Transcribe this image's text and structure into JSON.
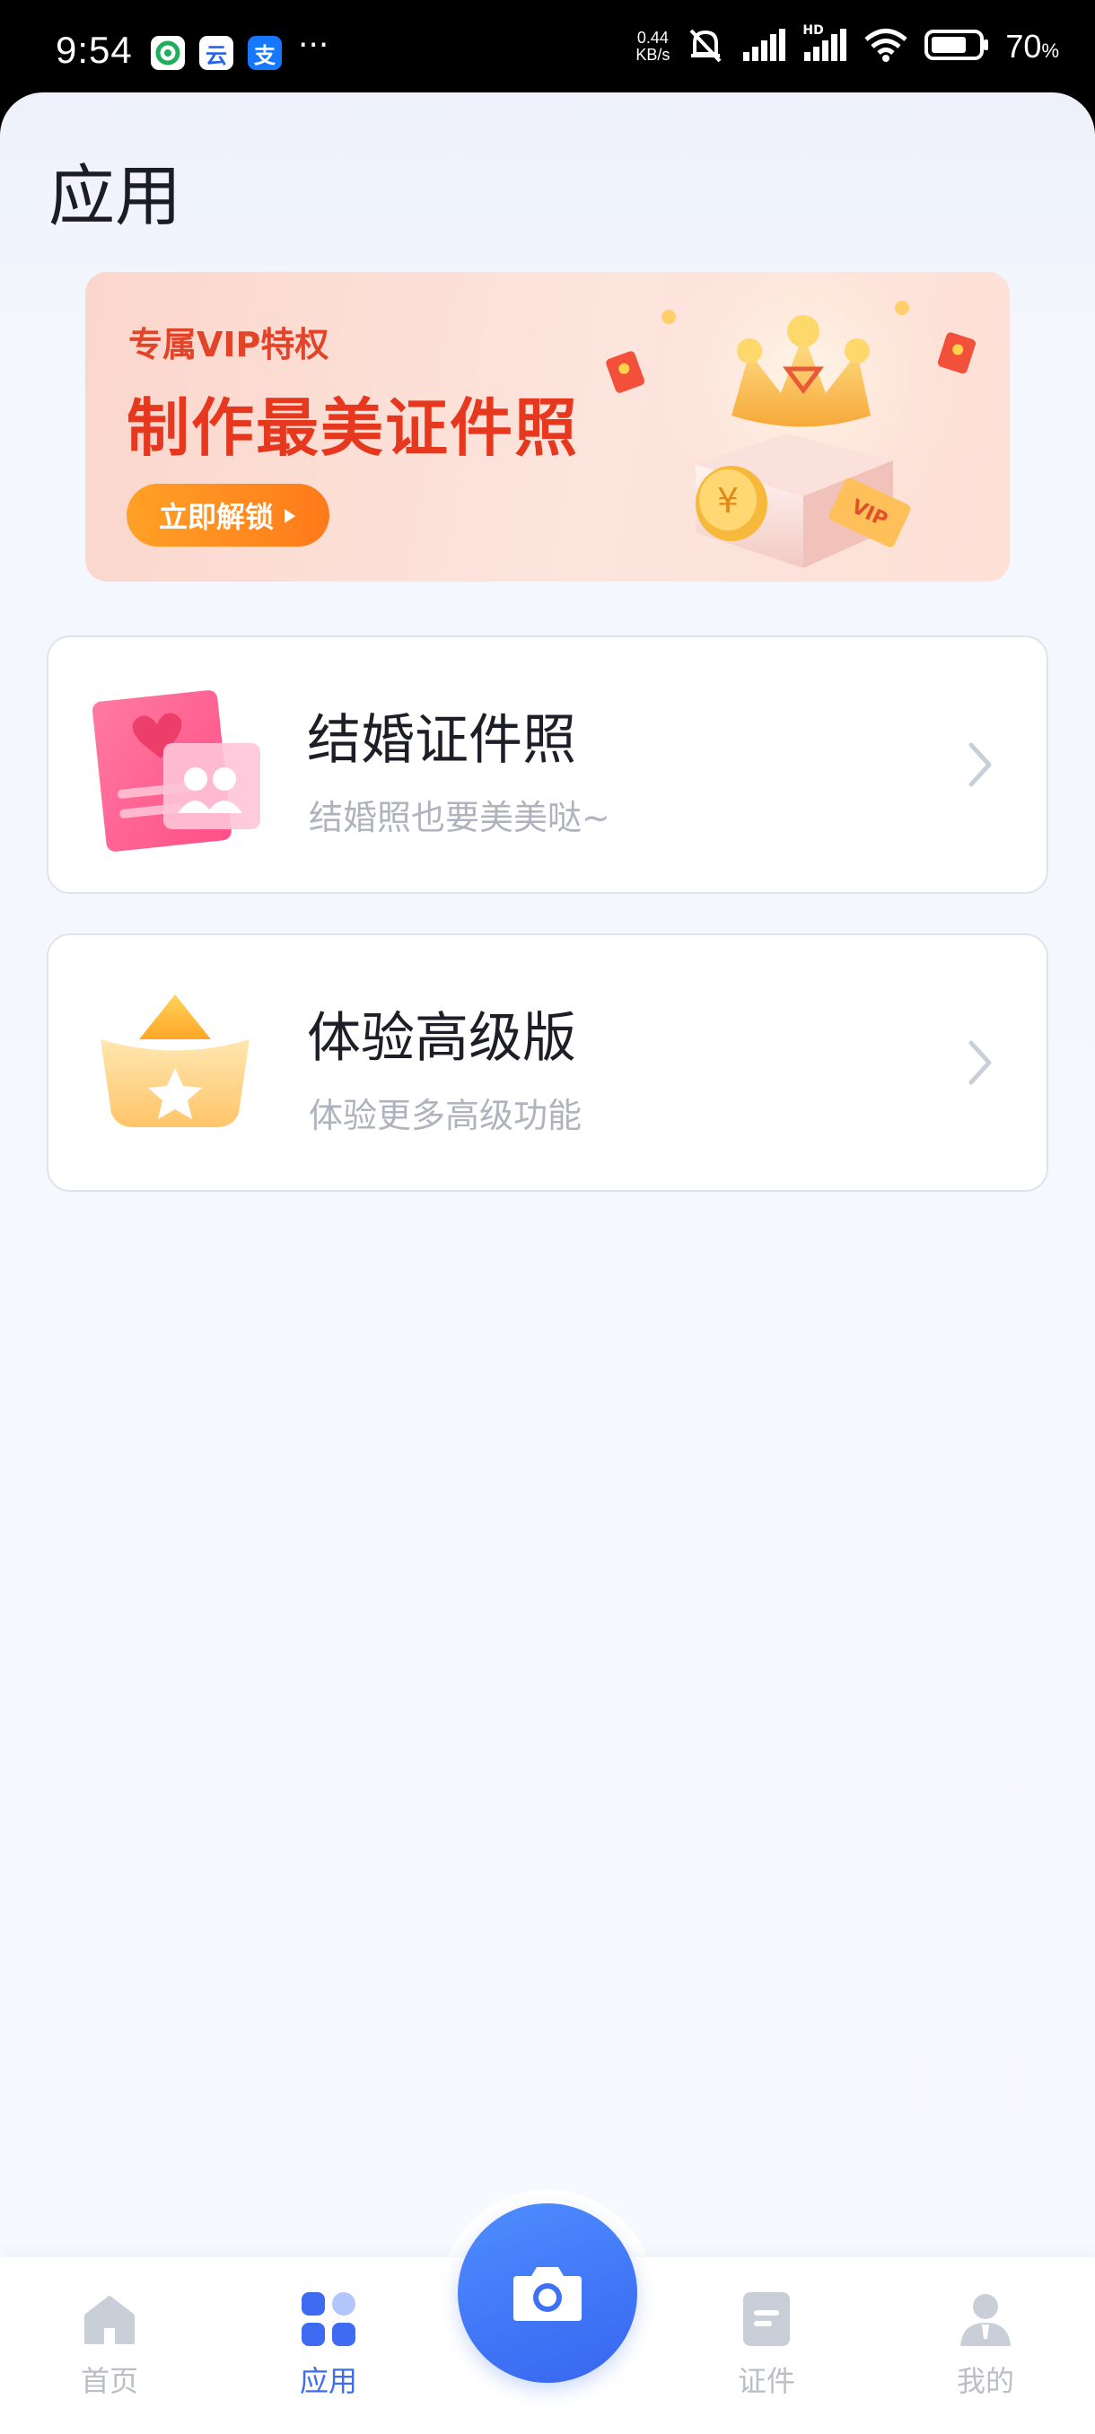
{
  "status_bar": {
    "time": "9:54",
    "apps": [
      "green-app-icon",
      "cloud-app-icon",
      "alipay-icon"
    ],
    "alipay_glyph": "支",
    "cloud_glyph": "云",
    "more": "···",
    "net_speed_value": "0.44",
    "net_speed_unit": "KB/s",
    "hd": "HD",
    "battery": "70",
    "battery_unit": "%"
  },
  "page": {
    "title": "应用"
  },
  "banner": {
    "subtitle": "专属VIP特权",
    "headline": "制作最美证件照",
    "button": "立即解锁",
    "vip_tag": "VIP",
    "coin_symbol": "¥"
  },
  "cards": [
    {
      "title": "结婚证件照",
      "subtitle": "结婚照也要美美哒~"
    },
    {
      "title": "体验高级版",
      "subtitle": "体验更多高级功能"
    }
  ],
  "tabbar": {
    "tabs": [
      {
        "label": "首页"
      },
      {
        "label": "应用"
      },
      {
        "label": "证件"
      },
      {
        "label": "我的"
      }
    ],
    "active_color": "#3d6cf3",
    "inactive_color": "#b9bec7"
  }
}
